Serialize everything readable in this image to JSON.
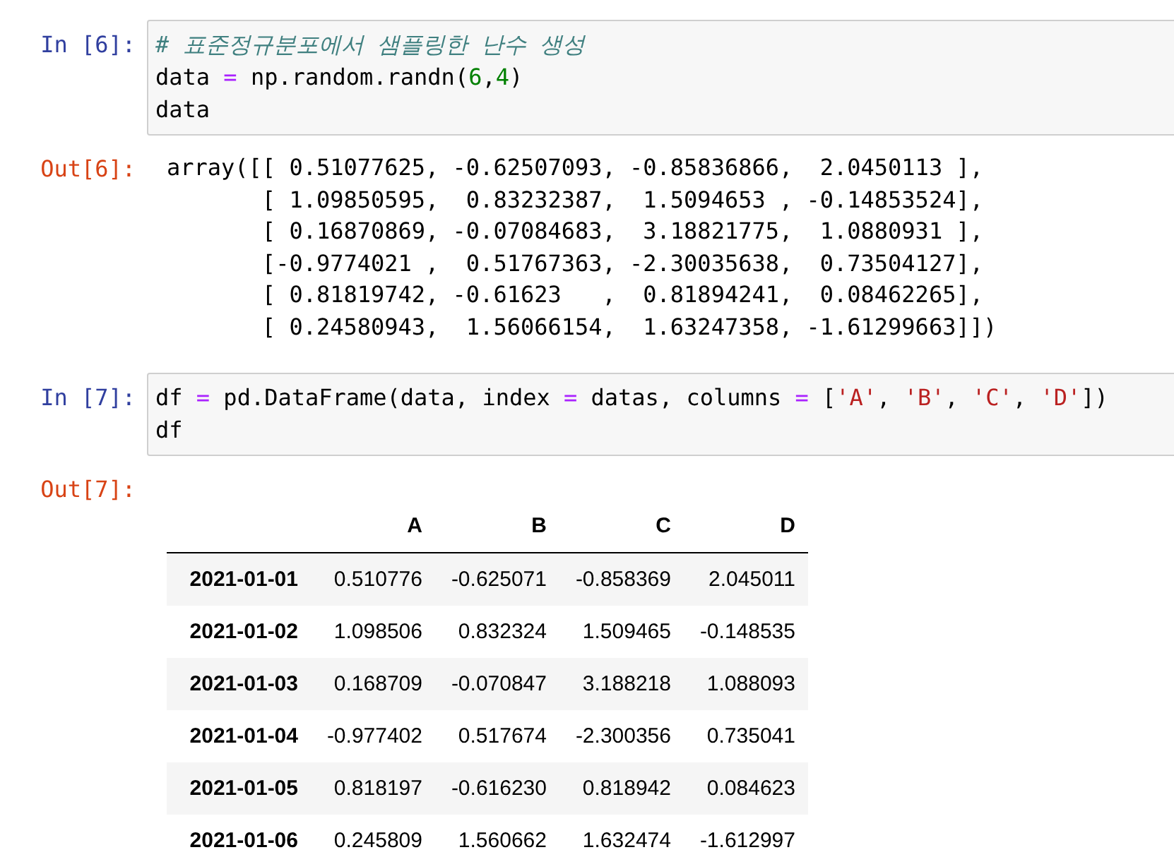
{
  "cells": [
    {
      "input": {
        "prompt": "In [6]:",
        "lines": [
          [
            {
              "kind": "comment",
              "text": "# 표준정규분포에서 샘플링한 난수 생성"
            }
          ],
          [
            {
              "kind": "plain",
              "text": "data "
            },
            {
              "kind": "operator",
              "text": "="
            },
            {
              "kind": "plain",
              "text": " np.random.randn("
            },
            {
              "kind": "number",
              "text": "6"
            },
            {
              "kind": "plain",
              "text": ","
            },
            {
              "kind": "number",
              "text": "4"
            },
            {
              "kind": "plain",
              "text": ")"
            }
          ],
          [
            {
              "kind": "plain",
              "text": "data"
            }
          ]
        ]
      },
      "output": {
        "prompt": "Out[6]:",
        "kind": "text",
        "lines": [
          "array([[ 0.51077625, -0.62507093, -0.85836866,  2.0450113 ],",
          "       [ 1.09850595,  0.83232387,  1.5094653 , -0.14853524],",
          "       [ 0.16870869, -0.07084683,  3.18821775,  1.0880931 ],",
          "       [-0.9774021 ,  0.51767363, -2.30035638,  0.73504127],",
          "       [ 0.81819742, -0.61623   ,  0.81894241,  0.08462265],",
          "       [ 0.24580943,  1.56066154,  1.63247358, -1.61299663]])"
        ]
      }
    },
    {
      "input": {
        "prompt": "In [7]:",
        "lines": [
          [
            {
              "kind": "plain",
              "text": "df "
            },
            {
              "kind": "operator",
              "text": "="
            },
            {
              "kind": "plain",
              "text": " pd.DataFrame(data, index "
            },
            {
              "kind": "operator",
              "text": "="
            },
            {
              "kind": "plain",
              "text": " datas, columns "
            },
            {
              "kind": "operator",
              "text": "="
            },
            {
              "kind": "plain",
              "text": " ["
            },
            {
              "kind": "string",
              "text": "'A'"
            },
            {
              "kind": "plain",
              "text": ", "
            },
            {
              "kind": "string",
              "text": "'B'"
            },
            {
              "kind": "plain",
              "text": ", "
            },
            {
              "kind": "string",
              "text": "'C'"
            },
            {
              "kind": "plain",
              "text": ", "
            },
            {
              "kind": "string",
              "text": "'D'"
            },
            {
              "kind": "plain",
              "text": "])"
            }
          ],
          [
            {
              "kind": "plain",
              "text": "df"
            }
          ]
        ]
      },
      "output": {
        "prompt": "Out[7]:",
        "kind": "table",
        "columns": [
          "A",
          "B",
          "C",
          "D"
        ],
        "rows": [
          {
            "index": "2021-01-01",
            "values": [
              "0.510776",
              "-0.625071",
              "-0.858369",
              "2.045011"
            ]
          },
          {
            "index": "2021-01-02",
            "values": [
              "1.098506",
              "0.832324",
              "1.509465",
              "-0.148535"
            ]
          },
          {
            "index": "2021-01-03",
            "values": [
              "0.168709",
              "-0.070847",
              "3.188218",
              "1.088093"
            ]
          },
          {
            "index": "2021-01-04",
            "values": [
              "-0.977402",
              "0.517674",
              "-2.300356",
              "0.735041"
            ]
          },
          {
            "index": "2021-01-05",
            "values": [
              "0.818197",
              "-0.616230",
              "0.818942",
              "0.084623"
            ]
          },
          {
            "index": "2021-01-06",
            "values": [
              "0.245809",
              "1.560662",
              "1.632474",
              "-1.612997"
            ]
          }
        ]
      }
    }
  ]
}
